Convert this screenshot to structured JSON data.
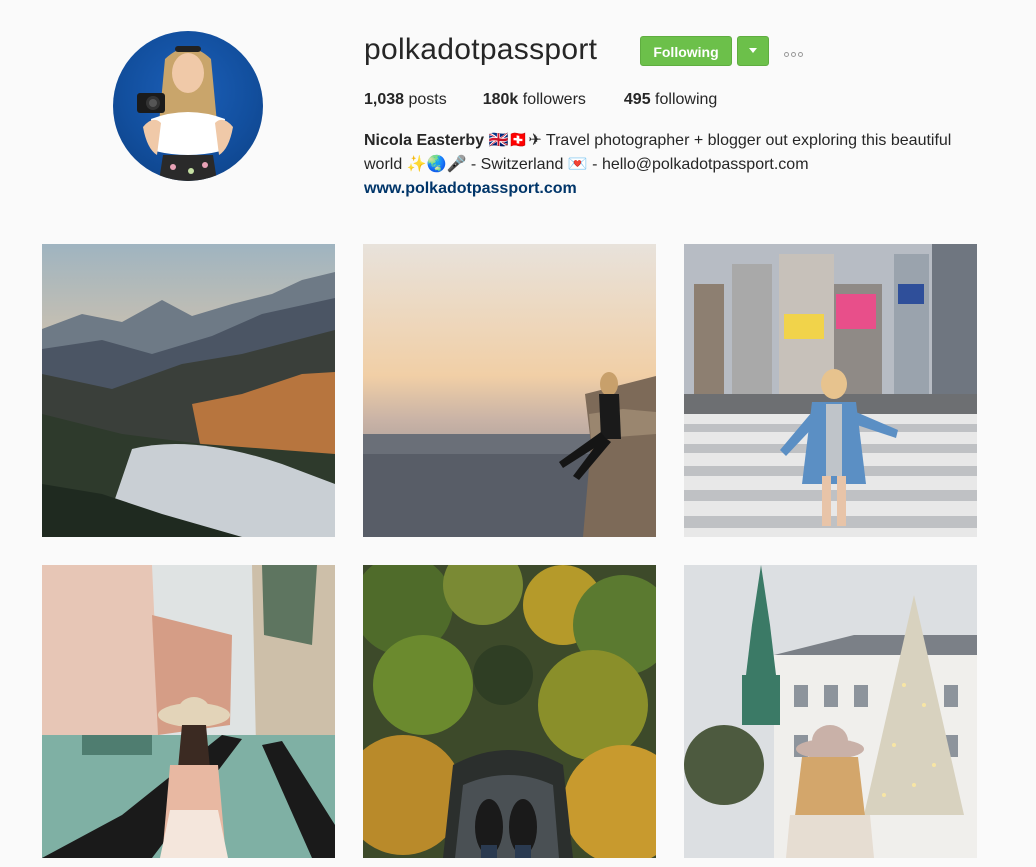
{
  "profile": {
    "username": "polkadotpassport",
    "following_button": "Following"
  },
  "stats": {
    "posts_count": "1,038",
    "posts_label": " posts",
    "followers_count": "180k",
    "followers_label": " followers",
    "following_count": "495",
    "following_label": " following"
  },
  "bio": {
    "name": "Nicola Easterby",
    "line1_text": " 🇬🇧🇨🇭✈ Travel photographer + blogger out exploring this beautiful",
    "line2_text": "world ✨🌏🎤 - Switzerland 💌 - hello@polkadotpassport.com",
    "website": "www.polkadotpassport.com"
  },
  "posts": [
    {
      "subject": "mountain-valley-sunset"
    },
    {
      "subject": "woman-on-ledge-above-city"
    },
    {
      "subject": "woman-in-city-crosswalk"
    },
    {
      "subject": "venice-gondola"
    },
    {
      "subject": "forest-canyon-feet"
    },
    {
      "subject": "christmas-tree-square"
    }
  ],
  "colors": {
    "follow_green": "#6cc04a",
    "link_blue": "#003569",
    "background": "#fafafa"
  }
}
